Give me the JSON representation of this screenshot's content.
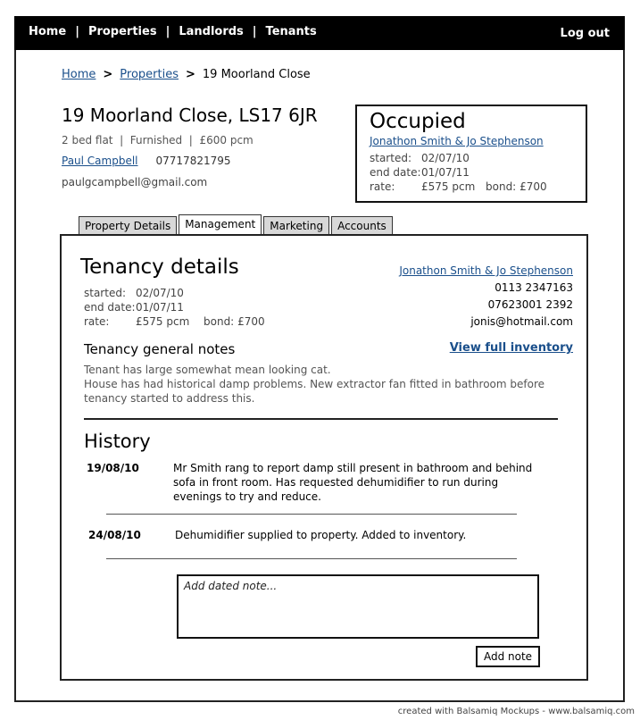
{
  "nav": {
    "items": [
      "Home",
      "Properties",
      "Landlords",
      "Tenants"
    ],
    "separator": "|",
    "logout": "Log out"
  },
  "breadcrumb": {
    "home": "Home",
    "properties": "Properties",
    "current": "19 Moorland Close",
    "chevron": ">"
  },
  "property": {
    "address": "19 Moorland Close, LS17 6JR",
    "summary": "2 bed flat  |  Furnished  |  £600 pcm",
    "landlord_name": "Paul Campbell",
    "landlord_phone": "07717821795",
    "landlord_email": "paulgcampbell@gmail.com"
  },
  "occupancy": {
    "status": "Occupied",
    "tenants": "Jonathon Smith & Jo Stephenson",
    "started_label": "started:",
    "started": "02/07/10",
    "end_label": "end date:",
    "end": "01/07/11",
    "rate_label": "rate:",
    "rate": "£575 pcm",
    "bond_label": "bond:",
    "bond": "£700"
  },
  "tabs": [
    {
      "label": "Property Details",
      "active": false
    },
    {
      "label": "Management",
      "active": true
    },
    {
      "label": "Marketing",
      "active": false
    },
    {
      "label": "Accounts",
      "active": false
    }
  ],
  "tenancy": {
    "heading": "Tenancy details",
    "started_label": "started:",
    "started": "02/07/10",
    "end_label": "end date:",
    "end": "01/07/11",
    "rate_label": "rate:",
    "rate": "£575 pcm",
    "bond_label": "bond:",
    "bond": "£700",
    "tenants": "Jonathon Smith & Jo Stephenson",
    "phone1": "0113 2347163",
    "phone2": "07623001 2392",
    "email": "jonis@hotmail.com",
    "notes_heading": "Tenancy general notes",
    "inventory_link": "View full inventory",
    "notes": "Tenant has large somewhat mean looking cat.\nHouse has had historical damp problems.  New extractor fan fitted in bathroom before tenancy started to address this."
  },
  "history": {
    "heading": "History",
    "entries": [
      {
        "date": "19/08/10",
        "text": "Mr Smith rang to report damp still present in bathroom and behind sofa in front room. Has requested dehumidifier to run during evenings to try and reduce."
      },
      {
        "date": "24/08/10",
        "text": "Dehumidifier supplied to property. Added to inventory."
      }
    ],
    "note_placeholder": "Add dated note...",
    "add_button": "Add note"
  },
  "footer": "created with Balsamiq Mockups - www.balsamiq.com"
}
